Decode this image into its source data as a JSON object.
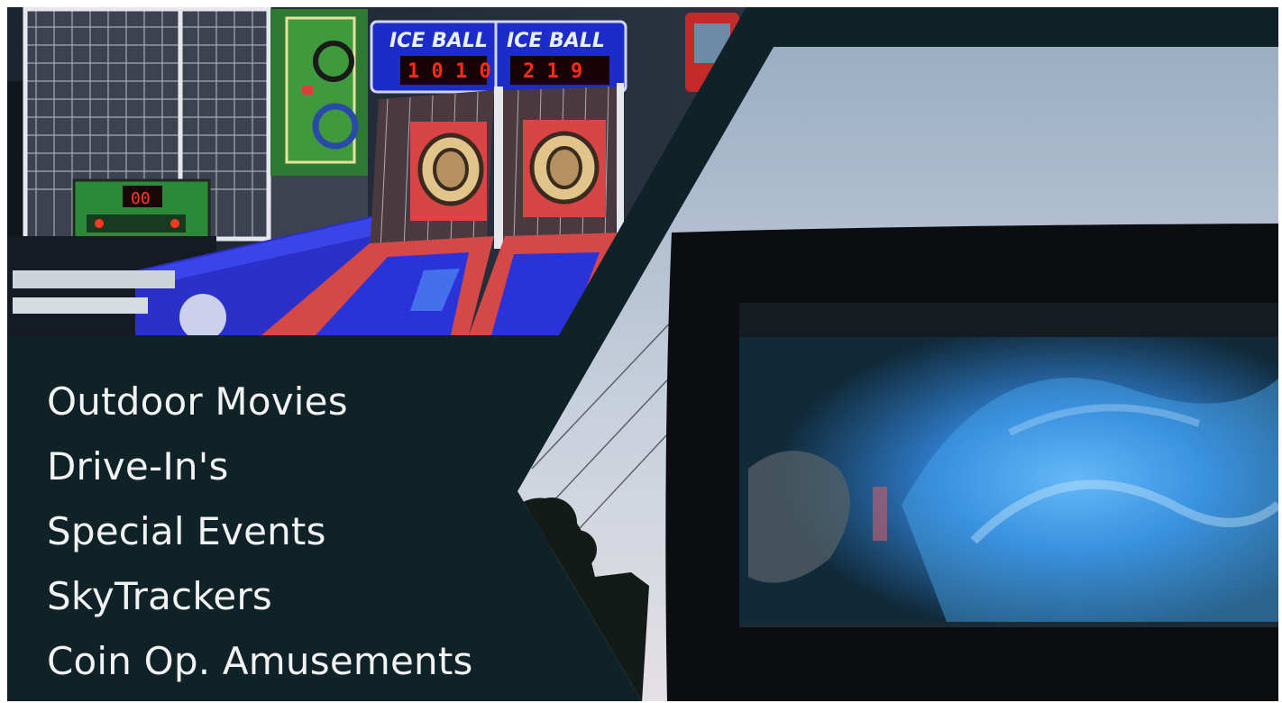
{
  "services": [
    "Outdoor Movies",
    "Drive-In's",
    "Special Events",
    "SkyTrackers",
    "Coin Op. Amusements"
  ],
  "arcade": {
    "sign_text": [
      "ICE BALL",
      "ICE BALL"
    ],
    "scores": [
      "1 0 1 0",
      "2 1 9"
    ],
    "football_score": "00"
  },
  "colors": {
    "panel": "#0f2227",
    "sky_top": "#9fb2c6",
    "sky_bottom": "#dde0e6",
    "neon_blue": "#2e3cf0",
    "lane_red": "#d84a4a",
    "score_red": "#ff2a1a",
    "screen_blue": "#3a8fd8"
  }
}
